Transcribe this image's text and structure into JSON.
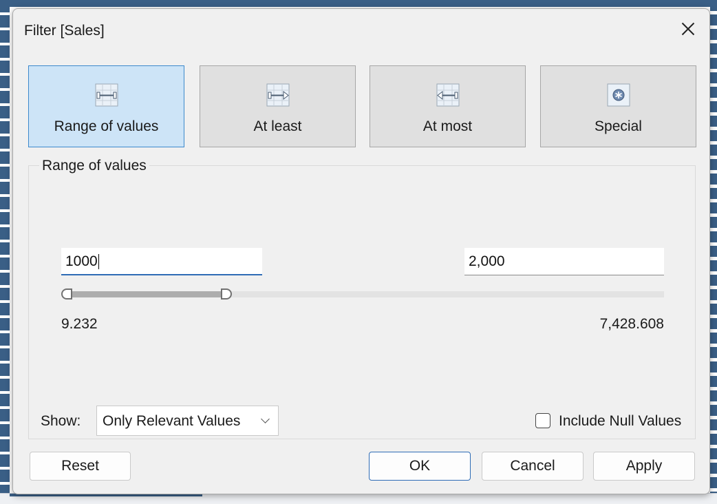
{
  "dialog": {
    "title": "Filter [Sales]"
  },
  "modes": [
    {
      "label": "Range of values",
      "icon": "range-icon",
      "active": true
    },
    {
      "label": "At least",
      "icon": "at-least-icon",
      "active": false
    },
    {
      "label": "At most",
      "icon": "at-most-icon",
      "active": false
    },
    {
      "label": "Special",
      "icon": "special-icon",
      "active": false
    }
  ],
  "range": {
    "group_label": "Range of values",
    "min_input": "1000",
    "max_input": "2,000",
    "domain_min_label": "9.232",
    "domain_max_label": "7,428.608",
    "domain_min": 9.232,
    "domain_max": 7428.608,
    "selected_min": 9.232,
    "selected_max": 2000
  },
  "show": {
    "label": "Show:",
    "selected": "Only Relevant Values"
  },
  "include_null": {
    "label": "Include Null Values",
    "checked": false
  },
  "buttons": {
    "reset": "Reset",
    "ok": "OK",
    "cancel": "Cancel",
    "apply": "Apply"
  },
  "colors": {
    "active_mode_bg": "#cde4f7",
    "active_mode_border": "#3b88cc",
    "focus_underline": "#2d6bb5"
  }
}
